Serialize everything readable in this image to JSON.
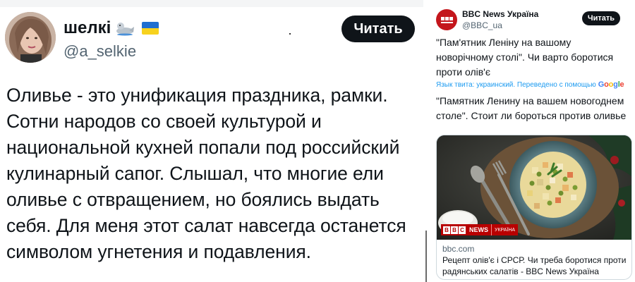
{
  "left_tweet": {
    "author_name": "шелкі",
    "author_handle": "@a_selkie",
    "read_button": "Читать",
    "body_lines": [
      "Оливье - это унификация праздника, рамки.",
      "Сотни народов со своей культурой и",
      "национальной кухней попали под российский",
      "кулинарный сапог. Слышал, что многие ели",
      "оливье с отвращением, но боялись выдать",
      "себя. Для меня этот салат навсегда останется",
      "символом угнетения и подавления."
    ],
    "emoji_icons": [
      "seal-icon",
      "ukraine-flag-icon"
    ]
  },
  "right_tweet": {
    "author_name": "BBC News Україна",
    "author_handle": "@BBC_ua",
    "read_button": "Читать",
    "original_text": "\"Пам'ятник Леніну на вашому новорічному столі\". Чи варто боротися проти олів'є",
    "translation_note": "Язык твита: украинский. Переведено с помощью",
    "translation_provider": "Google",
    "translated_text": "\"Памятник Ленину на вашем новогоднем столе\". Стоит ли бороться против оливье",
    "card": {
      "badge_news": "NEWS",
      "badge_sub": "УКРАЇНА",
      "domain": "bbc.com",
      "title": "Рецепт олів'є і СРСР. Чи треба боротися проти радянських салатів - BBC News Україна"
    }
  },
  "colors": {
    "accent_blue": "#1d9bf0",
    "bbc_red": "#b80000",
    "text_primary": "#0f1419",
    "text_secondary": "#536471",
    "button_bg": "#0f1419"
  }
}
